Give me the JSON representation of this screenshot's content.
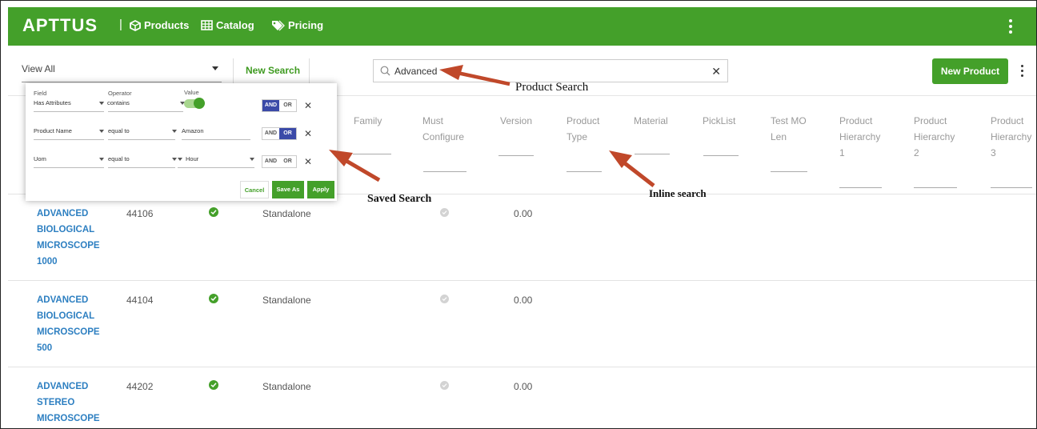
{
  "topbar": {
    "brand": "APTTUS",
    "separator": "|",
    "nav": [
      {
        "label": "Products",
        "icon": "cube-icon"
      },
      {
        "label": "Catalog",
        "icon": "grid-icon"
      },
      {
        "label": "Pricing",
        "icon": "tag-icon"
      }
    ],
    "accent": "#44a02a"
  },
  "toolbar": {
    "view_select": "View All",
    "new_search_label": "New Search",
    "search": {
      "value": "Advanced"
    },
    "new_product_label": "New Product"
  },
  "filter_panel": {
    "headers": {
      "field": "Field",
      "operator": "Operator",
      "value": "Value"
    },
    "rows": [
      {
        "field": "Has Attributes",
        "operator": "contains",
        "value": "",
        "and": "AND",
        "or": "OR",
        "active": "AND"
      },
      {
        "field": "Product Name",
        "operator": "equal to",
        "value": "Amazon",
        "and": "AND",
        "or": "OR",
        "active": "OR"
      },
      {
        "field": "Uom",
        "operator": "equal to",
        "value": "Hour",
        "and": "AND",
        "or": "OR",
        "active": "none"
      }
    ],
    "remove_glyph": "✕",
    "cancel_label": "Cancel",
    "save_as_label": "Save As",
    "apply_label": "Apply"
  },
  "table": {
    "headers": {
      "family": "Family",
      "must_configure": [
        "Must",
        "Configure"
      ],
      "version": "Version",
      "product_type": [
        "Product",
        "Type"
      ],
      "material": "Material",
      "picklist": "PickList",
      "test_mo_len": [
        "Test MO",
        "Len"
      ],
      "hierarchy_1": [
        "Product",
        "Hierarchy",
        "1"
      ],
      "hierarchy_2": [
        "Product",
        "Hierarchy",
        "2"
      ],
      "hierarchy_3": [
        "Product",
        "Hierarchy",
        "3"
      ]
    },
    "rows": [
      {
        "name": [
          "ADVANCED",
          "BIOLOGICAL",
          "MICROSCOPE",
          "1000"
        ],
        "code": "44106",
        "config_type": "Standalone",
        "version": "0.00"
      },
      {
        "name": [
          "ADVANCED",
          "BIOLOGICAL",
          "MICROSCOPE",
          "500"
        ],
        "code": "44104",
        "config_type": "Standalone",
        "version": "0.00"
      },
      {
        "name": [
          "ADVANCED",
          "STEREO",
          "MICROSCOPE"
        ],
        "code": "44202",
        "config_type": "Standalone",
        "version": "0.00"
      }
    ]
  },
  "annotations": {
    "product_search": "Product Search",
    "saved_search": "Saved Search",
    "inline_search": "Inline search",
    "arrow_color": "#c0482a"
  }
}
